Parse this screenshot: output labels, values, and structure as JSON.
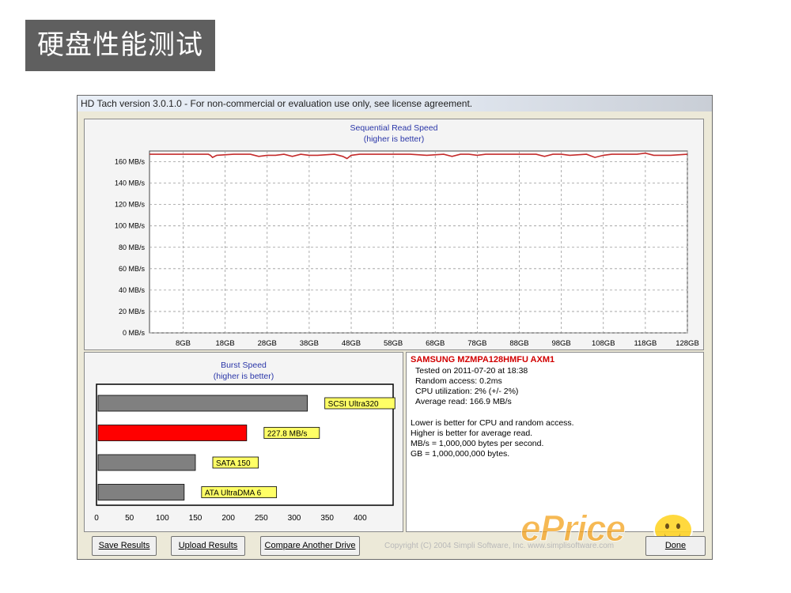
{
  "slide": {
    "title": "硬盘性能测试"
  },
  "window": {
    "title": "HD Tach version 3.0.1.0  - For non-commercial or evaluation use only, see license agreement."
  },
  "sequential": {
    "title": "Sequential Read Speed",
    "subtitle": "(higher is better)"
  },
  "burst": {
    "title": "Burst Speed",
    "subtitle": "(higher is better)"
  },
  "chart_data": [
    {
      "type": "line",
      "title": "Sequential Read Speed",
      "subtitle": "(higher is better)",
      "xlabel": "",
      "ylabel": "",
      "x_ticks": [
        "8GB",
        "18GB",
        "28GB",
        "38GB",
        "48GB",
        "58GB",
        "68GB",
        "78GB",
        "88GB",
        "98GB",
        "108GB",
        "118GB",
        "128GB"
      ],
      "y_ticks": [
        "0 MB/s",
        "20 MB/s",
        "40 MB/s",
        "60 MB/s",
        "80 MB/s",
        "100 MB/s",
        "120 MB/s",
        "140 MB/s",
        "160 MB/s"
      ],
      "xlim": [
        0,
        128
      ],
      "ylim": [
        0,
        170
      ],
      "grid": true,
      "series": [
        {
          "color": "#c42b2b",
          "x": [
            0,
            4,
            10,
            14,
            14.5,
            15,
            16,
            20,
            24,
            26,
            28,
            30,
            32,
            34,
            36,
            38,
            40,
            44,
            46,
            47,
            48,
            50,
            54,
            58,
            62,
            66,
            70,
            72,
            74,
            76,
            78,
            80,
            84,
            88,
            92,
            94,
            96,
            98,
            100,
            104,
            106,
            108,
            110,
            112,
            116,
            118,
            120,
            124,
            128
          ],
          "y": [
            167,
            167,
            167,
            167,
            166,
            164,
            166,
            167,
            167,
            165,
            166,
            166,
            167,
            165,
            167,
            166,
            166,
            167,
            165,
            163,
            166,
            167,
            167,
            167,
            167,
            166,
            167,
            165,
            167,
            167,
            166,
            167,
            167,
            167,
            167,
            165,
            167,
            167,
            166,
            167,
            164,
            166,
            167,
            167,
            167,
            168,
            166,
            166,
            167
          ]
        }
      ]
    },
    {
      "type": "bar",
      "orientation": "horizontal",
      "title": "Burst Speed",
      "subtitle": "(higher is better)",
      "xlim": [
        0,
        450
      ],
      "x_ticks": [
        "0",
        "50",
        "100",
        "150",
        "200",
        "250",
        "300",
        "350",
        "400"
      ],
      "grid": false,
      "bars": [
        {
          "label": "SCSI Ultra320",
          "value": 320,
          "color": "#808080"
        },
        {
          "label": "227.8 MB/s",
          "value": 227.8,
          "color": "#ff0000"
        },
        {
          "label": "SATA 150",
          "value": 150,
          "color": "#808080"
        },
        {
          "label": "ATA UltraDMA 6",
          "value": 133,
          "color": "#808080"
        }
      ]
    }
  ],
  "info": {
    "drive": "SAMSUNG MZMPA128HMFU AXM1",
    "tested_on": "Tested on 2011-07-20 at 18:38",
    "random_access": "Random access: 0.2ms",
    "cpu": "CPU utilization: 2% (+/- 2%)",
    "average_read": "Average read: 166.9 MB/s",
    "note1": "Lower is better for CPU and random access.",
    "note2": "Higher is better for average read.",
    "note3": "MB/s = 1,000,000 bytes per second.",
    "note4": "GB = 1,000,000,000 bytes."
  },
  "buttons": {
    "save": "Save Results",
    "upload": "Upload Results",
    "compare": "Compare Another Drive",
    "done": "Done"
  },
  "footer": {
    "copyright": "Copyright (C) 2004 Simpli Software, Inc. www.simplisoftware.com"
  },
  "watermark": {
    "brand": "ePrice"
  }
}
